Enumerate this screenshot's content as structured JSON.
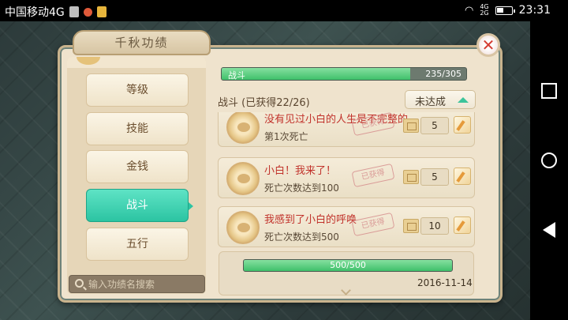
{
  "statusbar": {
    "carrier": "中国移动4G",
    "net_top": "4G",
    "net_bottom": "2G",
    "time": "23:31",
    "battery_level": 0.5
  },
  "panel": {
    "title": "千秋功绩",
    "close_symbol": "✕"
  },
  "categories": [
    {
      "label": "等级"
    },
    {
      "label": "技能"
    },
    {
      "label": "金钱"
    },
    {
      "label": "战斗",
      "active": true
    },
    {
      "label": "五行"
    }
  ],
  "search": {
    "placeholder": "输入功绩名搜索"
  },
  "top_progress": {
    "label": "战斗",
    "count": "235/305",
    "value": 0.77
  },
  "sub_header": "战斗 (已获得22/26)",
  "filter": {
    "label": "未达成"
  },
  "achievements": [
    {
      "name": "没有见过小白的人生是不完整的",
      "desc": "第1次死亡",
      "stamp": "已获得",
      "reward": "5"
    },
    {
      "name": "小白！我来了！",
      "desc": "死亡次数达到100",
      "stamp": "已获得",
      "reward": "5"
    },
    {
      "name": "我感到了小白的呼唤",
      "desc": "死亡次数达到500",
      "stamp": "已获得",
      "reward": "10"
    }
  ],
  "bottom_progress": {
    "label": "500/500",
    "value": 1.0
  },
  "date": "2016-11-14",
  "colors": {
    "accent_green": "#2cc4a2",
    "close_red": "#d43b31",
    "achievement_name_red": "#c1322b"
  }
}
